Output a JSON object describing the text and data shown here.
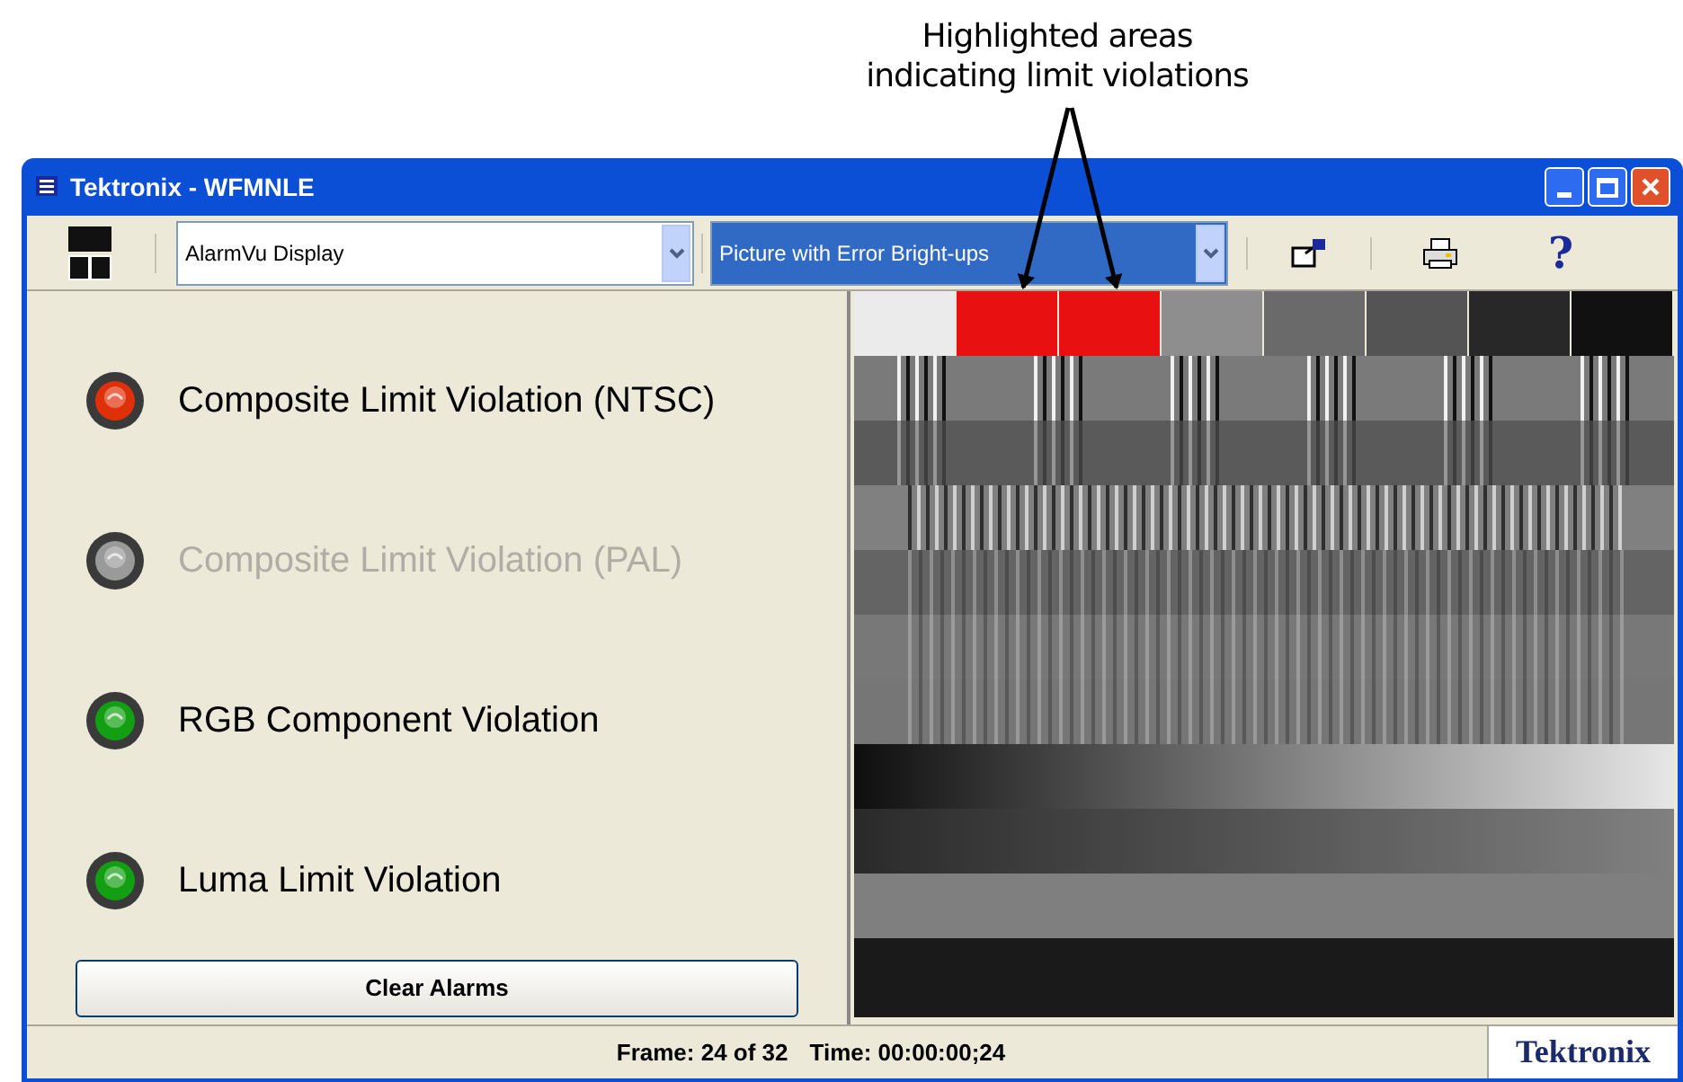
{
  "callout": {
    "lines": [
      "Highlighted areas",
      "indicating limit violations"
    ]
  },
  "window": {
    "title": "Tektronix - WFMNLE"
  },
  "toolbar": {
    "display_select": {
      "value": "AlarmVu Display",
      "focused": false
    },
    "picture_select": {
      "value": "Picture with Error Bright-ups",
      "focused": true
    },
    "help": "?"
  },
  "alarms": [
    {
      "label": "Composite Limit Violation (NTSC)",
      "color": "#e0300a",
      "disabled": false
    },
    {
      "label": "Composite Limit Violation (PAL)",
      "color": "#9a9a9a",
      "disabled": true
    },
    {
      "label": "RGB Component Violation",
      "color": "#12a012",
      "disabled": false
    },
    {
      "label": "Luma Limit Violation",
      "color": "#12a012",
      "disabled": false
    }
  ],
  "clear_button": "Clear Alarms",
  "status_bar": {
    "frame": "Frame: 24 of 32",
    "time": "Time: 00:00:00;24",
    "logo": "Tektronix"
  }
}
